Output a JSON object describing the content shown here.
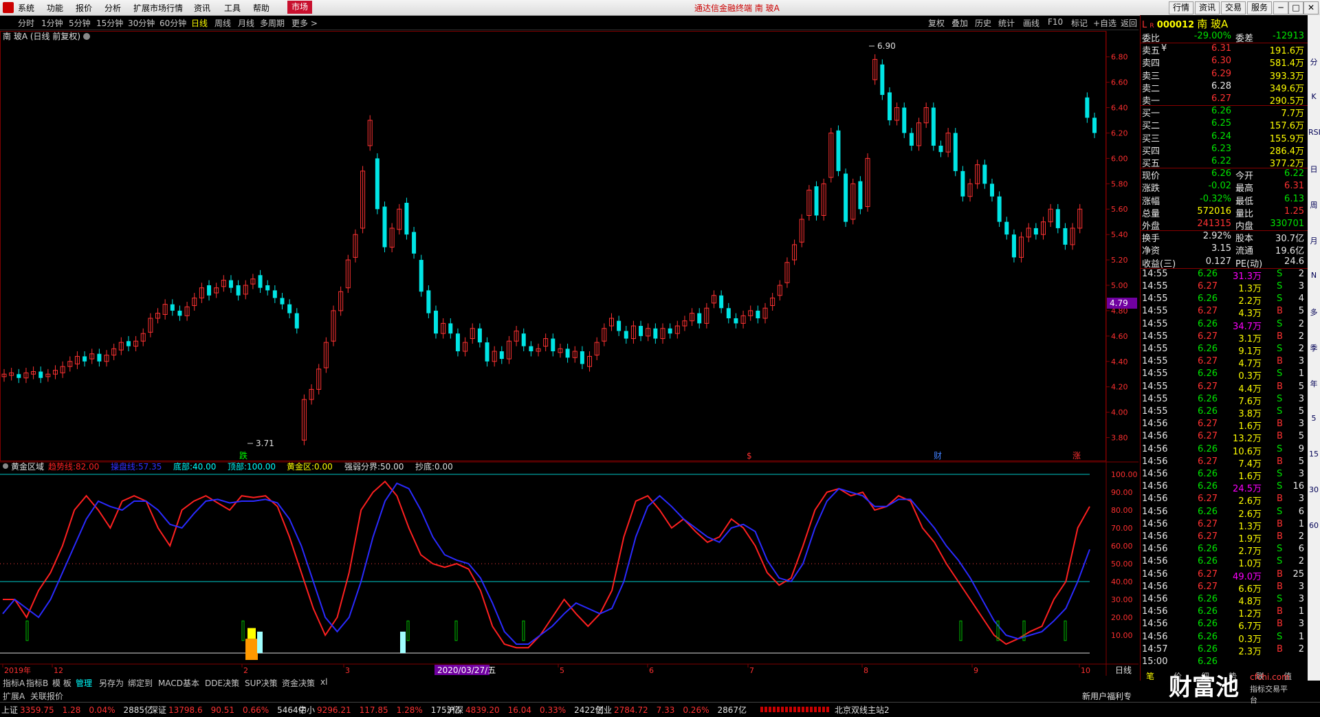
{
  "app": {
    "menu": [
      "系统",
      "功能",
      "报价",
      "分析",
      "扩展市场行情",
      "资讯",
      "工具",
      "帮助"
    ],
    "market_button": "市场",
    "window_title": "通达信金融终端 南 玻A",
    "top_right_buttons": [
      "行情",
      "资讯",
      "交易",
      "服务"
    ],
    "window_controls": [
      "─",
      "□",
      "✕"
    ]
  },
  "toolbar": {
    "periods": [
      "分时",
      "1分钟",
      "5分钟",
      "15分钟",
      "30分钟",
      "60分钟",
      "日线",
      "周线",
      "月线",
      "多周期",
      "更多 >"
    ],
    "active_period": "日线",
    "right_tools": [
      "复权",
      "叠加",
      "历史",
      "统计",
      "画线",
      "F10",
      "标记",
      "+自选",
      "返回"
    ]
  },
  "chart": {
    "title": "南 玻A (日线 前复权)",
    "price_axis": [
      "6.80",
      "6.60",
      "6.40",
      "6.20",
      "6.00",
      "5.80",
      "5.60",
      "5.40",
      "5.20",
      "5.00",
      "4.80",
      "4.60",
      "4.40",
      "4.20",
      "4.00",
      "3.80"
    ],
    "high_label": "6.90",
    "low_label": "3.71",
    "cursor_price": "4.79",
    "event_marks": [
      {
        "text": "跌",
        "color": "#00ff00"
      },
      {
        "text": "$",
        "color": "#ff3030"
      },
      {
        "text": "财",
        "color": "#4080ff"
      },
      {
        "text": "涨",
        "color": "#ff3030"
      }
    ],
    "indicator": {
      "name": "黄金区域",
      "params": [
        {
          "label": "趋势线:",
          "value": "82.00",
          "color": "#ff2020"
        },
        {
          "label": "操盘线:",
          "value": "57.35",
          "color": "#3030ff"
        },
        {
          "label": "底部:",
          "value": "40.00",
          "color": "#00ffff"
        },
        {
          "label": "顶部:",
          "value": "100.00",
          "color": "#00ffff"
        },
        {
          "label": "黄金区:",
          "value": "0.00",
          "color": "#ffff00"
        },
        {
          "label": "强弱分界:",
          "value": "50.00",
          "color": "#e0e0e0"
        },
        {
          "label": "抄底:",
          "value": "0.00",
          "color": "#e0e0e0"
        }
      ],
      "axis": [
        "100.00",
        "90.00",
        "80.00",
        "70.00",
        "60.00",
        "50.00",
        "40.00",
        "30.00",
        "20.00",
        "10.00"
      ]
    },
    "date_axis": [
      "2019年",
      "12",
      "2",
      "3",
      "5",
      "6",
      "7",
      "8",
      "9",
      "10"
    ],
    "date_cursor": "2020/03/27/五",
    "period_label": "日线",
    "zoom_buttons": [
      "+",
      "-"
    ]
  },
  "chart_data": {
    "type": "candlestick",
    "title": "南 玻A (日线 前复权)",
    "ylim": [
      3.7,
      6.95
    ],
    "candles": [
      [
        4.28,
        4.3
      ],
      [
        4.29,
        4.31
      ],
      [
        4.3,
        4.27
      ],
      [
        4.27,
        4.31
      ],
      [
        4.3,
        4.32
      ],
      [
        4.32,
        4.27
      ],
      [
        4.28,
        4.3
      ],
      [
        4.3,
        4.33
      ],
      [
        4.31,
        4.36
      ],
      [
        4.36,
        4.4
      ],
      [
        4.38,
        4.44
      ],
      [
        4.44,
        4.4
      ],
      [
        4.42,
        4.46
      ],
      [
        4.46,
        4.4
      ],
      [
        4.4,
        4.45
      ],
      [
        4.45,
        4.5
      ],
      [
        4.49,
        4.55
      ],
      [
        4.56,
        4.52
      ],
      [
        4.52,
        4.56
      ],
      [
        4.56,
        4.62
      ],
      [
        4.63,
        4.74
      ],
      [
        4.74,
        4.78
      ],
      [
        4.77,
        4.85
      ],
      [
        4.85,
        4.8
      ],
      [
        4.8,
        4.76
      ],
      [
        4.76,
        4.83
      ],
      [
        4.84,
        4.9
      ],
      [
        4.9,
        4.98
      ],
      [
        5.0,
        4.92
      ],
      [
        4.94,
        4.98
      ],
      [
        4.99,
        5.04
      ],
      [
        5.04,
        4.98
      ],
      [
        5.0,
        4.92
      ],
      [
        4.93,
        5.0
      ],
      [
        5.01,
        5.05
      ],
      [
        5.08,
        4.98
      ],
      [
        5.0,
        4.96
      ],
      [
        4.96,
        4.9
      ],
      [
        4.9,
        4.85
      ],
      [
        4.85,
        4.78
      ],
      [
        4.78,
        4.66
      ],
      [
        3.78,
        4.1
      ],
      [
        4.1,
        4.18
      ],
      [
        4.18,
        4.34
      ],
      [
        4.35,
        4.55
      ],
      [
        4.56,
        4.8
      ],
      [
        4.8,
        4.95
      ],
      [
        4.98,
        5.2
      ],
      [
        5.22,
        5.4
      ],
      [
        5.45,
        5.9
      ],
      [
        6.1,
        6.3
      ],
      [
        6.0,
        5.6
      ],
      [
        5.62,
        5.3
      ],
      [
        5.3,
        5.45
      ],
      [
        5.44,
        5.6
      ],
      [
        5.65,
        5.4
      ],
      [
        5.42,
        5.25
      ],
      [
        5.2,
        4.95
      ],
      [
        4.96,
        4.78
      ],
      [
        4.8,
        4.62
      ],
      [
        4.62,
        4.7
      ],
      [
        4.7,
        4.62
      ],
      [
        4.62,
        4.48
      ],
      [
        4.48,
        4.55
      ],
      [
        4.58,
        4.66
      ],
      [
        4.66,
        4.55
      ],
      [
        4.55,
        4.4
      ],
      [
        4.4,
        4.48
      ],
      [
        4.48,
        4.42
      ],
      [
        4.42,
        4.56
      ],
      [
        4.56,
        4.64
      ],
      [
        4.62,
        4.52
      ],
      [
        4.52,
        4.48
      ],
      [
        4.48,
        4.5
      ],
      [
        4.52,
        4.58
      ],
      [
        4.58,
        4.48
      ],
      [
        4.47,
        4.5
      ],
      [
        4.5,
        4.43
      ],
      [
        4.43,
        4.48
      ],
      [
        4.48,
        4.38
      ],
      [
        4.36,
        4.44
      ],
      [
        4.45,
        4.55
      ],
      [
        4.56,
        4.66
      ],
      [
        4.68,
        4.74
      ],
      [
        4.72,
        4.64
      ],
      [
        4.64,
        4.58
      ],
      [
        4.58,
        4.68
      ],
      [
        4.68,
        4.6
      ],
      [
        4.6,
        4.66
      ],
      [
        4.66,
        4.58
      ],
      [
        4.58,
        4.66
      ],
      [
        4.66,
        4.62
      ],
      [
        4.62,
        4.68
      ],
      [
        4.68,
        4.72
      ],
      [
        4.72,
        4.78
      ],
      [
        4.78,
        4.7
      ],
      [
        4.7,
        4.82
      ],
      [
        4.86,
        4.92
      ],
      [
        4.92,
        4.82
      ],
      [
        4.82,
        4.74
      ],
      [
        4.74,
        4.7
      ],
      [
        4.7,
        4.76
      ],
      [
        4.76,
        4.8
      ],
      [
        4.8,
        4.74
      ],
      [
        4.74,
        4.82
      ],
      [
        4.84,
        4.9
      ],
      [
        4.92,
        5.0
      ],
      [
        5.02,
        5.18
      ],
      [
        5.2,
        5.32
      ],
      [
        5.34,
        5.52
      ],
      [
        5.55,
        5.75
      ],
      [
        5.78,
        5.55
      ],
      [
        5.55,
        5.8
      ],
      [
        5.85,
        6.2
      ],
      [
        6.22,
        5.9
      ],
      [
        5.88,
        5.5
      ],
      [
        5.52,
        5.8
      ],
      [
        5.82,
        5.6
      ],
      [
        5.62,
        6.0
      ],
      [
        6.62,
        6.78
      ],
      [
        6.74,
        6.5
      ],
      [
        6.52,
        6.3
      ],
      [
        6.3,
        6.4
      ],
      [
        6.4,
        6.2
      ],
      [
        6.2,
        6.1
      ],
      [
        6.1,
        6.28
      ],
      [
        6.28,
        6.4
      ],
      [
        6.4,
        6.1
      ],
      [
        6.1,
        6.05
      ],
      [
        6.05,
        6.2
      ],
      [
        6.2,
        5.9
      ],
      [
        5.9,
        5.7
      ],
      [
        5.7,
        5.8
      ],
      [
        5.8,
        5.95
      ],
      [
        5.95,
        5.8
      ],
      [
        5.8,
        5.7
      ],
      [
        5.7,
        5.5
      ],
      [
        5.5,
        5.4
      ],
      [
        5.4,
        5.22
      ],
      [
        5.22,
        5.38
      ],
      [
        5.38,
        5.45
      ],
      [
        5.45,
        5.4
      ],
      [
        5.4,
        5.5
      ],
      [
        5.5,
        5.6
      ],
      [
        5.6,
        5.45
      ],
      [
        5.45,
        5.32
      ],
      [
        5.32,
        5.45
      ],
      [
        5.45,
        5.6
      ],
      [
        6.48,
        6.32
      ],
      [
        6.32,
        6.2
      ]
    ],
    "trend_line": [
      30,
      30,
      20,
      35,
      45,
      60,
      80,
      88,
      80,
      70,
      85,
      88,
      85,
      70,
      60,
      80,
      85,
      88,
      84,
      80,
      88,
      87,
      88,
      82,
      65,
      45,
      25,
      10,
      20,
      45,
      80,
      90,
      96,
      88,
      70,
      55,
      50,
      48,
      50,
      47,
      35,
      15,
      5,
      3,
      3,
      10,
      20,
      30,
      22,
      15,
      22,
      35,
      65,
      85,
      88,
      80,
      70,
      75,
      68,
      62,
      65,
      75,
      70,
      60,
      45,
      38,
      42,
      60,
      80,
      90,
      92,
      88,
      90,
      80,
      82,
      88,
      85,
      70,
      62,
      50,
      40,
      30,
      20,
      10,
      5,
      8,
      12,
      15,
      30,
      40,
      70,
      82
    ],
    "operate_line": [
      22,
      30,
      25,
      20,
      30,
      45,
      60,
      75,
      85,
      82,
      80,
      85,
      85,
      80,
      72,
      70,
      78,
      85,
      86,
      84,
      85,
      85,
      86,
      84,
      75,
      60,
      40,
      20,
      12,
      20,
      40,
      65,
      85,
      95,
      92,
      80,
      65,
      55,
      52,
      50,
      42,
      28,
      12,
      5,
      5,
      10,
      15,
      22,
      28,
      25,
      22,
      25,
      40,
      65,
      82,
      88,
      82,
      75,
      70,
      65,
      62,
      70,
      72,
      68,
      52,
      42,
      40,
      50,
      70,
      85,
      92,
      90,
      88,
      82,
      82,
      86,
      86,
      78,
      70,
      60,
      52,
      42,
      30,
      18,
      10,
      8,
      10,
      12,
      18,
      25,
      40,
      58
    ]
  },
  "quote_panel": {
    "code": "000012",
    "name": "南 玻A",
    "lr_tag": "L",
    "r_tag": "R",
    "weibi": {
      "label": "委比",
      "value": "-29.00%",
      "label2": "委差",
      "value2": "-12913"
    },
    "asks": [
      {
        "label": "卖五",
        "tag": "¥",
        "price": "6.31",
        "vol": "191.6万"
      },
      {
        "label": "卖四",
        "tag": "",
        "price": "6.30",
        "vol": "581.4万"
      },
      {
        "label": "卖三",
        "tag": "",
        "price": "6.29",
        "vol": "393.3万"
      },
      {
        "label": "卖二",
        "tag": "",
        "price": "6.28",
        "vol": "349.6万"
      },
      {
        "label": "卖一",
        "tag": "",
        "price": "6.27",
        "vol": "290.5万"
      }
    ],
    "bids": [
      {
        "label": "买一",
        "price": "6.26",
        "vol": "7.7万"
      },
      {
        "label": "买二",
        "price": "6.25",
        "vol": "157.6万"
      },
      {
        "label": "买三",
        "price": "6.24",
        "vol": "155.9万"
      },
      {
        "label": "买四",
        "price": "6.23",
        "vol": "286.4万"
      },
      {
        "label": "买五",
        "price": "6.22",
        "vol": "377.2万"
      }
    ],
    "stats": [
      {
        "l1": "现价",
        "v1": "6.26",
        "c1": "grn",
        "l2": "今开",
        "v2": "6.22",
        "c2": "grn"
      },
      {
        "l1": "涨跌",
        "v1": "-0.02",
        "c1": "grn",
        "l2": "最高",
        "v2": "6.31",
        "c2": "red"
      },
      {
        "l1": "涨幅",
        "v1": "-0.32%",
        "c1": "grn",
        "l2": "最低",
        "v2": "6.13",
        "c2": "grn"
      },
      {
        "l1": "总量",
        "v1": "572016",
        "c1": "yel",
        "l2": "量比",
        "v2": "1.25",
        "c2": "red"
      },
      {
        "l1": "外盘",
        "v1": "241315",
        "c1": "red",
        "l2": "内盘",
        "v2": "330701",
        "c2": "grn"
      }
    ],
    "finance": [
      {
        "l1": "换手",
        "v1": "2.92%",
        "l2": "股本",
        "v2": "30.7亿"
      },
      {
        "l1": "净资",
        "v1": "3.15",
        "l2": "流通",
        "v2": "19.6亿"
      },
      {
        "l1": "收益(三)",
        "v1": "0.127",
        "l2": "PE(动)",
        "v2": "24.6"
      }
    ],
    "ticks": [
      [
        "14:55",
        "6.26",
        "31.3万",
        "S",
        "2"
      ],
      [
        "14:55",
        "6.27",
        "1.3万",
        "S",
        "3"
      ],
      [
        "14:55",
        "6.26",
        "2.2万",
        "S",
        "4"
      ],
      [
        "14:55",
        "6.27",
        "4.3万",
        "B",
        "5"
      ],
      [
        "14:55",
        "6.26",
        "34.7万",
        "S",
        "2"
      ],
      [
        "14:55",
        "6.27",
        "3.1万",
        "B",
        "2"
      ],
      [
        "14:55",
        "6.26",
        "9.1万",
        "S",
        "2"
      ],
      [
        "14:55",
        "6.27",
        "4.7万",
        "B",
        "3"
      ],
      [
        "14:55",
        "6.26",
        "0.3万",
        "S",
        "1"
      ],
      [
        "14:55",
        "6.27",
        "4.4万",
        "B",
        "5"
      ],
      [
        "14:55",
        "6.26",
        "7.6万",
        "S",
        "3"
      ],
      [
        "14:55",
        "6.26",
        "3.8万",
        "S",
        "5"
      ],
      [
        "14:56",
        "6.27",
        "1.6万",
        "B",
        "3"
      ],
      [
        "14:56",
        "6.27",
        "13.2万",
        "B",
        "5"
      ],
      [
        "14:56",
        "6.26",
        "10.6万",
        "S",
        "9"
      ],
      [
        "14:56",
        "6.27",
        "7.4万",
        "B",
        "5"
      ],
      [
        "14:56",
        "6.26",
        "1.6万",
        "S",
        "3"
      ],
      [
        "14:56",
        "6.26",
        "24.5万",
        "S",
        "16"
      ],
      [
        "14:56",
        "6.27",
        "2.6万",
        "B",
        "3"
      ],
      [
        "14:56",
        "6.26",
        "2.6万",
        "S",
        "6"
      ],
      [
        "14:56",
        "6.27",
        "1.3万",
        "B",
        "1"
      ],
      [
        "14:56",
        "6.27",
        "1.9万",
        "B",
        "2"
      ],
      [
        "14:56",
        "6.26",
        "2.7万",
        "S",
        "6"
      ],
      [
        "14:56",
        "6.26",
        "1.0万",
        "S",
        "2"
      ],
      [
        "14:56",
        "6.27",
        "49.0万",
        "B",
        "25"
      ],
      [
        "14:56",
        "6.27",
        "6.6万",
        "B",
        "3"
      ],
      [
        "14:56",
        "6.26",
        "4.8万",
        "S",
        "3"
      ],
      [
        "14:56",
        "6.26",
        "1.2万",
        "B",
        "1"
      ],
      [
        "14:56",
        "6.26",
        "6.7万",
        "B",
        "3"
      ],
      [
        "14:56",
        "6.26",
        "0.3万",
        "S",
        "1"
      ],
      [
        "14:57",
        "6.26",
        "2.3万",
        "B",
        "2"
      ],
      [
        "15:00",
        "6.26",
        "",
        "",
        ""
      ]
    ],
    "footer": [
      "笔",
      "价",
      "细",
      "势",
      "联",
      "值"
    ]
  },
  "sidebar_icons": [
    "分",
    "K",
    "RSI",
    "日",
    "周",
    "月",
    "N",
    "多",
    "季",
    "年",
    "5",
    "15",
    "30",
    "60"
  ],
  "bottom_tabs": [
    "指标A",
    "指标B",
    "模 板",
    "管理",
    "另存为",
    "绑定到",
    "MACD基本",
    "DDE决策",
    "SUP决策",
    "资金决策",
    "xl"
  ],
  "bottom_tabs2": [
    "扩展A",
    "关联报价"
  ],
  "status_bar": [
    {
      "name": "上证",
      "v": "3359.75",
      "chg": "1.28",
      "pct": "0.04%",
      "amt": "2885亿"
    },
    {
      "name": "深证",
      "v": "13798.6",
      "chg": "90.51",
      "pct": "0.66%",
      "amt": "5464亿"
    },
    {
      "name": "中小",
      "v": "9296.21",
      "chg": "117.85",
      "pct": "1.28%",
      "amt": "1753亿"
    },
    {
      "name": "沪深",
      "v": "4839.20",
      "chg": "16.04",
      "pct": "0.33%",
      "amt": "2422亿"
    },
    {
      "name": "创业",
      "v": "2784.72",
      "chg": "7.33",
      "pct": "0.26%",
      "amt": "2867亿"
    }
  ],
  "status_right": {
    "server": "北京双线主站2",
    "promo": "新用户福利专享"
  },
  "watermark": {
    "text": "财富池",
    "url": "cfchi.com",
    "sub": "指标交易平台"
  }
}
